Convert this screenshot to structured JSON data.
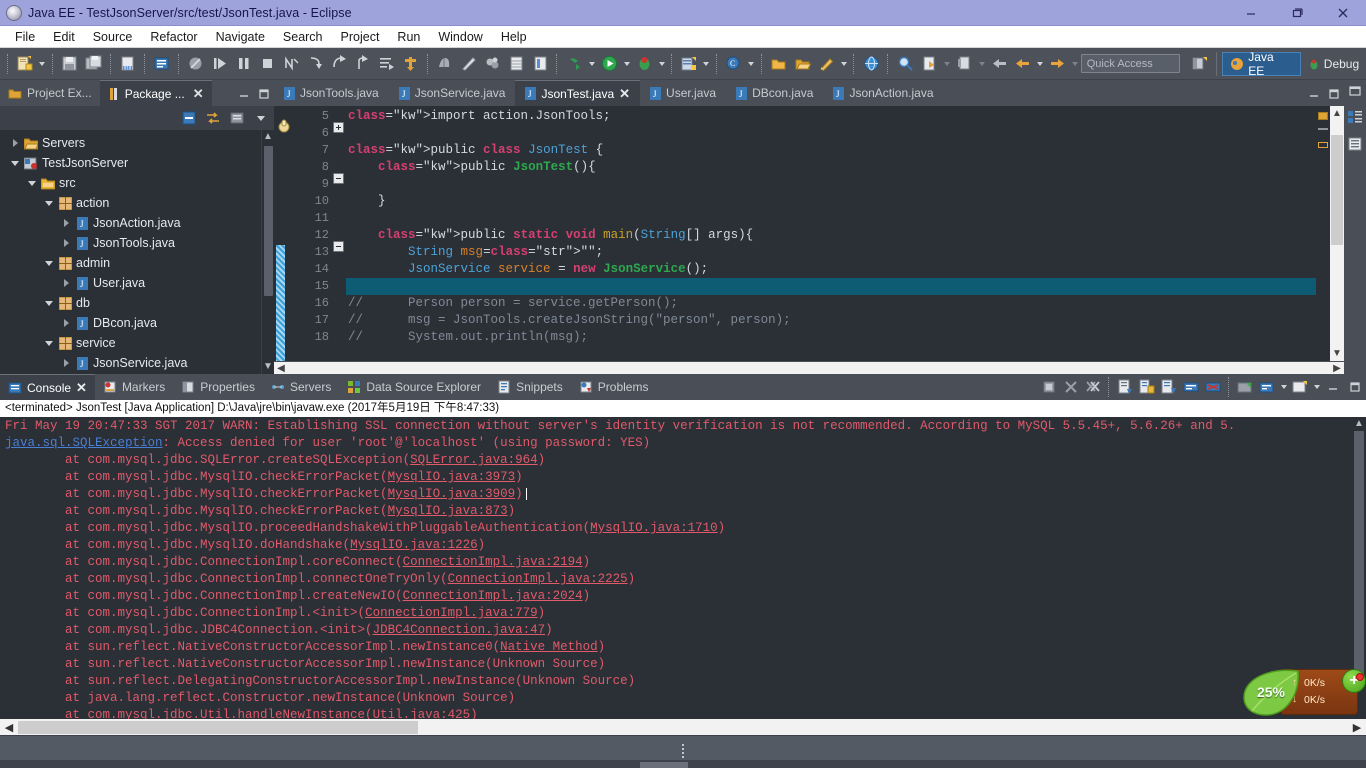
{
  "window": {
    "title": "Java EE - TestJsonServer/src/test/JsonTest.java - Eclipse",
    "minimize": "–",
    "maximize": "❐",
    "close": "✕"
  },
  "menubar": {
    "items": [
      "File",
      "Edit",
      "Source",
      "Refactor",
      "Navigate",
      "Search",
      "Project",
      "Run",
      "Window",
      "Help"
    ]
  },
  "toolbar": {
    "quick_access_placeholder": "Quick Access",
    "perspectives": [
      {
        "label": "Java EE",
        "active": true
      },
      {
        "label": "Debug",
        "active": false
      }
    ]
  },
  "left_panel": {
    "tabs": [
      {
        "label": "Project Ex...",
        "active": false,
        "icon": "project-explorer-icon"
      },
      {
        "label": "Package ...",
        "active": true,
        "icon": "package-explorer-icon",
        "closable": true
      }
    ],
    "tree": [
      {
        "label": "Servers",
        "depth": 0,
        "twist": "closed",
        "icon": "folder-icon"
      },
      {
        "label": "TestJsonServer",
        "depth": 0,
        "twist": "open",
        "icon": "java-project-icon"
      },
      {
        "label": "src",
        "depth": 1,
        "twist": "open",
        "icon": "source-folder-icon"
      },
      {
        "label": "action",
        "depth": 2,
        "twist": "open",
        "icon": "package-icon"
      },
      {
        "label": "JsonAction.java",
        "depth": 3,
        "twist": "closed",
        "icon": "java-file-icon"
      },
      {
        "label": "JsonTools.java",
        "depth": 3,
        "twist": "closed",
        "icon": "java-file-icon"
      },
      {
        "label": "admin",
        "depth": 2,
        "twist": "open",
        "icon": "package-icon"
      },
      {
        "label": "User.java",
        "depth": 3,
        "twist": "closed",
        "icon": "java-file-icon"
      },
      {
        "label": "db",
        "depth": 2,
        "twist": "open",
        "icon": "package-icon"
      },
      {
        "label": "DBcon.java",
        "depth": 3,
        "twist": "closed",
        "icon": "java-file-icon"
      },
      {
        "label": "service",
        "depth": 2,
        "twist": "open",
        "icon": "package-icon"
      },
      {
        "label": "JsonService.java",
        "depth": 3,
        "twist": "closed",
        "icon": "java-file-icon"
      }
    ]
  },
  "editor": {
    "tabs": [
      {
        "label": "JsonTools.java",
        "active": false
      },
      {
        "label": "JsonService.java",
        "active": false
      },
      {
        "label": "JsonTest.java",
        "active": true,
        "closable": true
      },
      {
        "label": "User.java",
        "active": false
      },
      {
        "label": "DBcon.java",
        "active": false
      },
      {
        "label": "JsonAction.java",
        "active": false
      }
    ],
    "line_numbers": [
      "5",
      "6",
      "7",
      "8",
      "9",
      "10",
      "11",
      "12",
      "13",
      "14",
      "15",
      "16",
      "17",
      "18"
    ],
    "lines": [
      "import action.JsonTools;",
      "",
      "public class JsonTest {",
      "    public JsonTest(){",
      "",
      "    }",
      "",
      "    public static void main(String[] args){",
      "        String msg=\"\";",
      "        JsonService service = new JsonService();",
      "",
      "//      Person person = service.getPerson();",
      "//      msg = JsonTools.createJsonString(\"person\", person);",
      "//      System.out.println(msg);"
    ]
  },
  "console_panel": {
    "tabs": [
      {
        "label": "Console",
        "active": true,
        "icon": "console-icon",
        "closable": true
      },
      {
        "label": "Markers",
        "active": false,
        "icon": "markers-icon"
      },
      {
        "label": "Properties",
        "active": false,
        "icon": "properties-icon"
      },
      {
        "label": "Servers",
        "active": false,
        "icon": "servers-icon"
      },
      {
        "label": "Data Source Explorer",
        "active": false,
        "icon": "data-source-icon"
      },
      {
        "label": "Snippets",
        "active": false,
        "icon": "snippets-icon"
      },
      {
        "label": "Problems",
        "active": false,
        "icon": "problems-icon"
      }
    ],
    "launch_header": "<terminated> JsonTest [Java Application] D:\\Java\\jre\\bin\\javaw.exe (2017年5月19日 下午8:47:33)",
    "output_lines": [
      "Fri May 19 20:47:33 SGT 2017 WARN: Establishing SSL connection without server's identity verification is not recommended. According to MySQL 5.5.45+, 5.6.26+ and 5.",
      "java.sql.SQLException: Access denied for user 'root'@'localhost' (using password: YES)",
      "\tat com.mysql.jdbc.SQLError.createSQLException(SQLError.java:964)",
      "\tat com.mysql.jdbc.MysqlIO.checkErrorPacket(MysqlIO.java:3973)",
      "\tat com.mysql.jdbc.MysqlIO.checkErrorPacket(MysqlIO.java:3909)",
      "\tat com.mysql.jdbc.MysqlIO.checkErrorPacket(MysqlIO.java:873)",
      "\tat com.mysql.jdbc.MysqlIO.proceedHandshakeWithPluggableAuthentication(MysqlIO.java:1710)",
      "\tat com.mysql.jdbc.MysqlIO.doHandshake(MysqlIO.java:1226)",
      "\tat com.mysql.jdbc.ConnectionImpl.coreConnect(ConnectionImpl.java:2194)",
      "\tat com.mysql.jdbc.ConnectionImpl.connectOneTryOnly(ConnectionImpl.java:2225)",
      "\tat com.mysql.jdbc.ConnectionImpl.createNewIO(ConnectionImpl.java:2024)",
      "\tat com.mysql.jdbc.ConnectionImpl.<init>(ConnectionImpl.java:779)",
      "\tat com.mysql.jdbc.JDBC4Connection.<init>(JDBC4Connection.java:47)",
      "\tat sun.reflect.NativeConstructorAccessorImpl.newInstance0(Native Method)",
      "\tat sun.reflect.NativeConstructorAccessorImpl.newInstance(Unknown Source)",
      "\tat sun.reflect.DelegatingConstructorAccessorImpl.newInstance(Unknown Source)",
      "\tat java.lang.reflect.Constructor.newInstance(Unknown Source)",
      "\tat com.mysql.jdbc.Util.handleNewInstance(Util.java:425)"
    ]
  },
  "net_widget": {
    "percent": "25%",
    "upload_rate": "0K/s",
    "download_rate": "0K/s",
    "upload_arrow": "↑",
    "download_arrow": "↓",
    "plus_label": "+"
  },
  "colors": {
    "title_bar": "#9fa3dc",
    "toolbar_bg": "#4c515a",
    "editor_bg": "#2b2f36",
    "panel_bg": "#3c4149",
    "accent_blue": "#2c5d8f",
    "error_red": "#e05a6a",
    "keyword_pink": "#d44070",
    "highlight_line": "#0d5c73"
  }
}
